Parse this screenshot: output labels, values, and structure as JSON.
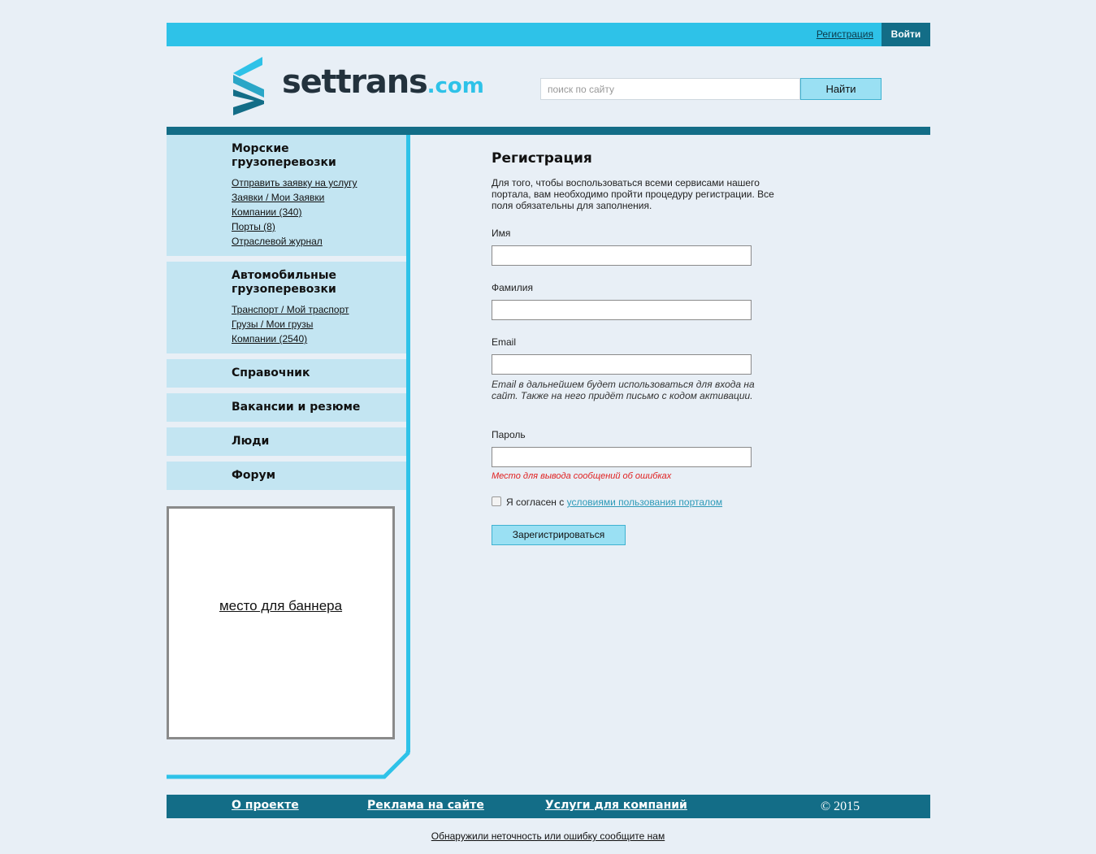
{
  "header": {
    "register_link": "Регистрация",
    "login_button": "Войти",
    "logo_main": "settrans",
    "logo_suffix": ".com",
    "search_placeholder": "поиск по сайту",
    "search_button": "Найти"
  },
  "sidebar": {
    "sea": {
      "title_line1": "Морские",
      "title_line2": "грузоперевозки",
      "links": [
        "Отправить заявку на услугу",
        "Заявки / Мои Заявки",
        "Компании (340)",
        "Порты (8)",
        "Отраслевой журнал"
      ]
    },
    "auto": {
      "title_line1": "Автомобильные",
      "title_line2": "грузоперевозки",
      "links": [
        "Транспорт / Мой траспорт",
        "Грузы / Мои грузы",
        "Компании (2540)"
      ]
    },
    "simple": [
      "Справочник",
      "Вакансии и резюме",
      "Люди",
      "Форум"
    ],
    "banner": "место для баннера"
  },
  "form": {
    "title": "Регистрация",
    "intro": "Для того, чтобы воспользоваться всеми сервисами нашего портала, вам необходимо пройти процедуру регистрации. Все поля обязательны для заполнения.",
    "fields": {
      "first_name": "Имя",
      "last_name": "Фамилия",
      "email": "Email",
      "password": "Пароль"
    },
    "email_hint": "Email в дальнейшем будет использоваться для входа на сайт. Также на него придёт письмо с кодом активации.",
    "error_placeholder": "Место для вывода сообщений об ошибках",
    "agree_prefix": "Я согласен с",
    "agree_link": "условиями пользования порталом",
    "submit": "Зарегистрироваться"
  },
  "footer": {
    "links": [
      "О проекте",
      "Реклама на сайте",
      "Услуги для компаний"
    ],
    "copyright": "© 2015",
    "report": "Обнаружили неточность или ошибку сообщите нам"
  },
  "colors": {
    "accent": "#2ec2e8",
    "dark": "#136d87",
    "sidebar_bg": "#c3e5f2",
    "page_bg": "#e8eff6",
    "error": "#e02020"
  }
}
